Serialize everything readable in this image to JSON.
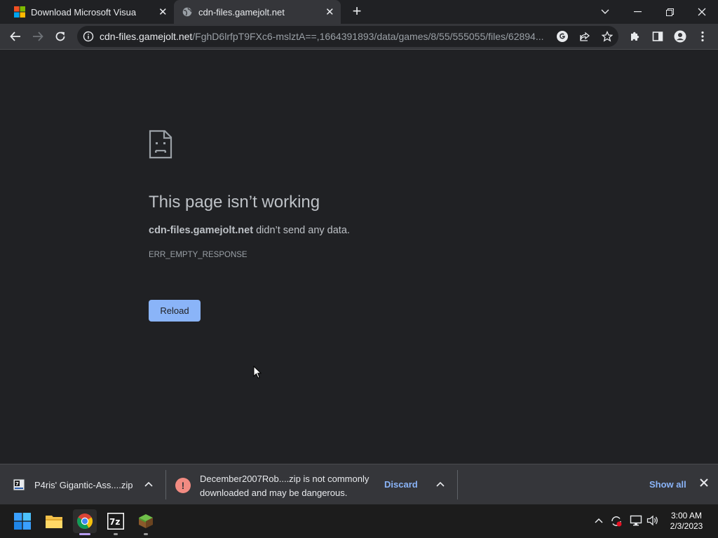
{
  "browser": {
    "tabs": [
      {
        "title": "Download Microsoft Visual C++",
        "icon": "windows-logo-icon",
        "active": false
      },
      {
        "title": "cdn-files.gamejolt.net",
        "icon": "globe-icon",
        "active": true
      }
    ],
    "address": {
      "host": "cdn-files.gamejolt.net",
      "path": "/FghD6lrfpT9FXc6-mslztA==,1664391893/data/games/8/55/555055/files/62894..."
    }
  },
  "error_page": {
    "title": "This page isn’t working",
    "host": "cdn-files.gamejolt.net",
    "message": " didn’t send any data.",
    "code": "ERR_EMPTY_RESPONSE",
    "reload_label": "Reload"
  },
  "downloads": {
    "items": [
      {
        "filename": "P4ris' Gigantic-Ass....zip"
      },
      {
        "warning": "December2007Rob....zip is not commonly downloaded and may be dangerous.",
        "action": "Discard"
      }
    ],
    "show_all_label": "Show all"
  },
  "taskbar": {
    "time": "3:00 AM",
    "date": "2/3/2023",
    "sevenzip_label": "7z"
  },
  "colors": {
    "page_bg": "#202124",
    "toolbar_bg": "#35363a",
    "accent": "#8ab4f8",
    "danger": "#f28b82"
  }
}
